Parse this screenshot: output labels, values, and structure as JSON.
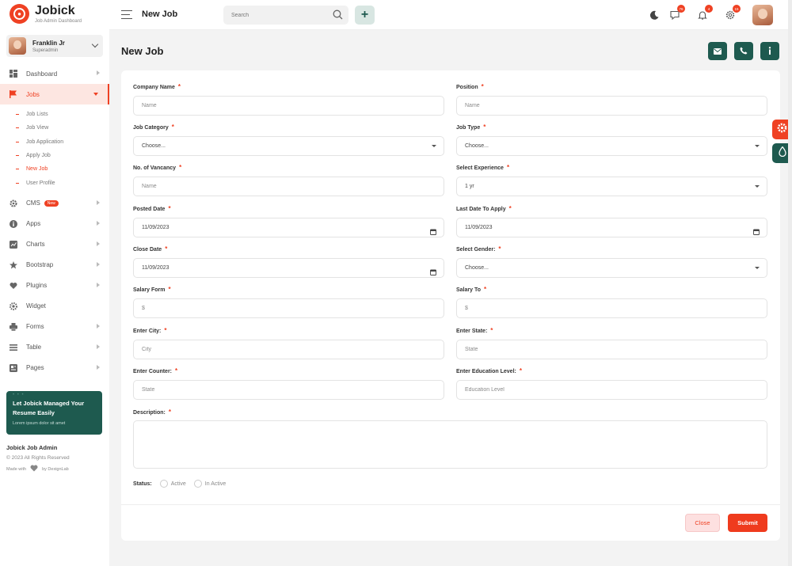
{
  "brand": {
    "name": "Jobick",
    "subtitle": "Job Admin Dashboard"
  },
  "profile": {
    "name": "Franklin Jr",
    "role": "Superadmin"
  },
  "sidebar": {
    "items": [
      {
        "label": "Dashboard",
        "icon": "grid-icon"
      },
      {
        "label": "Jobs",
        "icon": "flag-icon"
      },
      {
        "label": "CMS",
        "icon": "gear-icon",
        "badge": "New"
      },
      {
        "label": "Apps",
        "icon": "info-icon"
      },
      {
        "label": "Charts",
        "icon": "chart-icon"
      },
      {
        "label": "Bootstrap",
        "icon": "star-icon"
      },
      {
        "label": "Plugins",
        "icon": "heart-icon"
      },
      {
        "label": "Widget",
        "icon": "widget-icon"
      },
      {
        "label": "Forms",
        "icon": "printer-icon"
      },
      {
        "label": "Table",
        "icon": "table-icon"
      },
      {
        "label": "Pages",
        "icon": "pages-icon"
      }
    ],
    "subitems": [
      "Job Lists",
      "Job View",
      "Job Application",
      "Apply Job",
      "New Job",
      "User Profile"
    ],
    "promo": {
      "title": "Let Jobick Managed Your Resume Easily",
      "text": "Lorem ipsum dolor sit amet"
    },
    "footer": {
      "title": "Jobick Job Admin",
      "copyright": "© 2023 All Rights Reserved",
      "made_prefix": "Made with",
      "made_suffix": "by DexignLab"
    }
  },
  "header": {
    "title": "New Job",
    "search_placeholder": "Search",
    "plus": "+",
    "notifications": {
      "messages": "76",
      "bell": "4",
      "settings": "15"
    }
  },
  "page": {
    "title": "New Job"
  },
  "form": {
    "company_name": {
      "label": "Company Name",
      "placeholder": "Name"
    },
    "position": {
      "label": "Position",
      "placeholder": "Name"
    },
    "job_category": {
      "label": "Job Category",
      "value": "Choose..."
    },
    "job_type": {
      "label": "Job Type",
      "value": "Choose..."
    },
    "vacancy": {
      "label": "No. of Vancancy",
      "placeholder": "Name"
    },
    "experience": {
      "label": "Select Experience",
      "value": "1 yr"
    },
    "posted_date": {
      "label": "Posted Date",
      "value": "11/09/2023"
    },
    "last_date": {
      "label": "Last Date To Apply",
      "value": "11/09/2023"
    },
    "close_date": {
      "label": "Close Date",
      "value": "11/09/2023"
    },
    "gender": {
      "label": "Select Gender:",
      "value": "Choose..."
    },
    "salary_from": {
      "label": "Salary Form",
      "placeholder": "$"
    },
    "salary_to": {
      "label": "Salary To",
      "placeholder": "$"
    },
    "city": {
      "label": "Enter City:",
      "placeholder": "City"
    },
    "state": {
      "label": "Enter State:",
      "placeholder": "State"
    },
    "counter": {
      "label": "Enter Counter:",
      "placeholder": "State"
    },
    "education": {
      "label": "Enter Education Level:",
      "placeholder": "Education Level"
    },
    "description": {
      "label": "Description:"
    },
    "status": {
      "label": "Status:",
      "options": [
        "Active",
        "In Active"
      ]
    },
    "required_mark": "*"
  },
  "buttons": {
    "close": "Close",
    "submit": "Submit"
  },
  "colors": {
    "accent": "#ef4123",
    "brand_green": "#1e5a4f"
  }
}
